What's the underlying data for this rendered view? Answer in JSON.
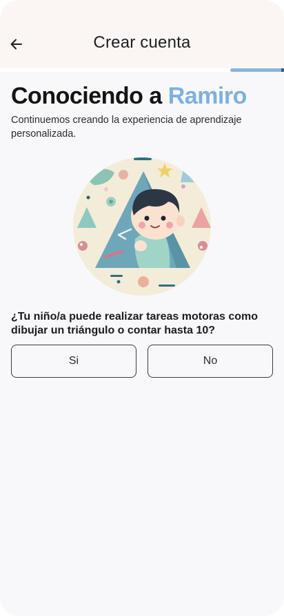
{
  "header": {
    "title": "Crear cuenta",
    "back_icon": "arrow-left-icon"
  },
  "progress": {
    "fraction": 0.19
  },
  "intro": {
    "heading_prefix": "Conociendo a ",
    "heading_name": "Ramiro",
    "subtitle": "Continuemos creando la experiencia de aprendizaje personalizada."
  },
  "question": {
    "text": "¿Tu niño/a puede realizar tareas motoras como dibujar un triángulo o contar hasta 10?",
    "options": [
      "Si",
      "No"
    ]
  },
  "colors": {
    "accent": "#7fb0dc",
    "progress": "#8ab5db",
    "header_bg": "#fbf6f4",
    "page_bg": "#f8f8fa"
  }
}
